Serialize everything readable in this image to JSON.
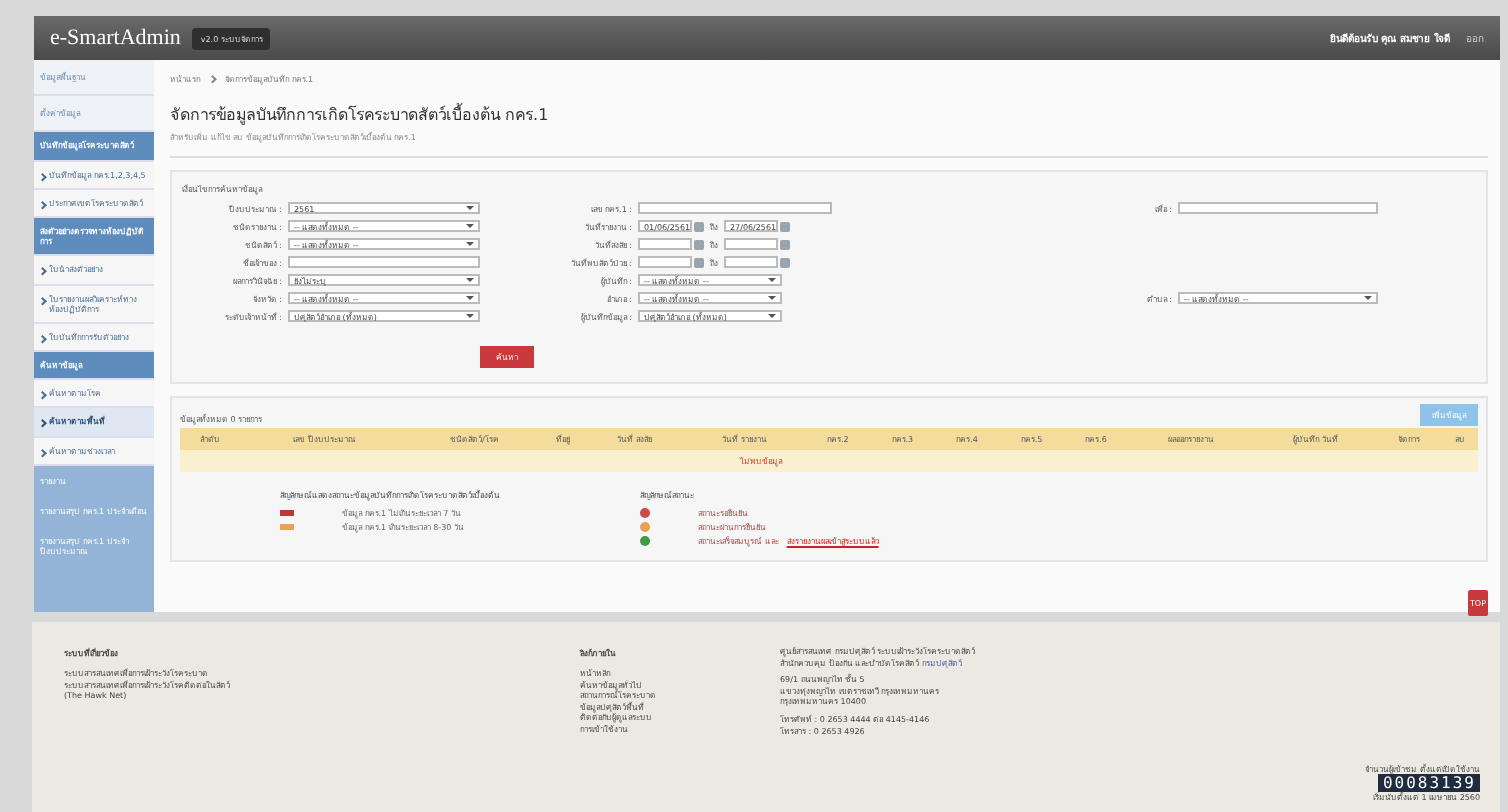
{
  "header": {
    "logo": "e-SmartAdmin",
    "version": "v2.0 ระบบจัดการ",
    "user": "ยินดีต้อนรับ คุณ สมชาย ใจดี",
    "logout": "ออก"
  },
  "sidebar": {
    "items": [
      {
        "kind": "menu",
        "label": "ข้อมูลพื้นฐาน",
        "selected": false
      },
      {
        "kind": "menu",
        "label": "ตั้งค่าข้อมูล",
        "selected": false
      },
      {
        "kind": "group",
        "label": "บันทึกข้อมูลโรคระบาดสัตว์",
        "selected": false
      },
      {
        "kind": "link",
        "label": "บันทึกข้อมูล กคร.1,2,3,4,5",
        "selected": false
      },
      {
        "kind": "link",
        "label": "ประกาศเขตโรคระบาดสัตว์",
        "selected": false
      },
      {
        "kind": "group",
        "label": "ส่งตัวอย่างตรวจทางห้องปฏิบัติการ",
        "selected": false
      },
      {
        "kind": "link",
        "label": "ใบนำส่งตัวอย่าง",
        "selected": false
      },
      {
        "kind": "link",
        "label": "ใบรายงานผลวิเคราะห์ทางห้องปฏิบัติการ",
        "selected": false
      },
      {
        "kind": "link",
        "label": "ใบบันทึกการรับตัวอย่าง",
        "selected": false
      },
      {
        "kind": "group",
        "label": "ค้นหาข้อมูล",
        "selected": false
      },
      {
        "kind": "link",
        "label": "ค้นหาตามโรค",
        "selected": false
      },
      {
        "kind": "link",
        "label": "ค้นหาตามพื้นที่",
        "selected": true
      },
      {
        "kind": "link",
        "label": "ค้นหาตามช่วงเวลา",
        "selected": false
      },
      {
        "kind": "panel",
        "label": "รายงาน",
        "selected": false
      },
      {
        "kind": "panel",
        "label": "รายงานสรุป กคร.1 ประจำเดือน",
        "selected": false
      },
      {
        "kind": "panel",
        "label": "รายงานสรุป กคร.1 ประจำปีงบประมาณ",
        "selected": false
      }
    ]
  },
  "breadcrumb": [
    "หน้าแรก",
    "จัดการข้อมูลบันทึก กคร.1"
  ],
  "title": "จัดการข้อมูลบันทึกการเกิดโรคระบาดสัตว์เบื้องต้น กคร.1",
  "subtitle": "สำหรับเพิ่ม แก้ไข ลบ ข้อมูลบันทึกการเกิดโรคระบาดสัตว์เบื้องต้น กคร.1",
  "search": {
    "heading": "เงื่อนไขการค้นหาข้อมูล",
    "rows": [
      {
        "left": {
          "kind": "select",
          "label": "ปีงบประมาณ :",
          "value": "2561"
        },
        "middle": {
          "kind": "text",
          "label": "เลข กคร.1 :"
        },
        "right": {
          "kind": "text",
          "label": "เพื่อ :"
        }
      },
      {
        "left": {
          "kind": "select",
          "label": "ชนิดรายงาน :",
          "value": "-- แสดงทั้งหมด --"
        },
        "middle": {
          "kind": "daterange",
          "label": "วันที่รายงาน :",
          "from": "01/06/2561",
          "to": "27/06/2561",
          "sep": "ถึง"
        }
      },
      {
        "left": {
          "kind": "select",
          "label": "ชนิดสัตว์ :",
          "value": "-- แสดงทั้งหมด --"
        },
        "middle": {
          "kind": "daterange",
          "label": "วันที่สงสัย :",
          "sep": "ถึง"
        }
      },
      {
        "left": {
          "kind": "text",
          "label": "ชื่อเจ้าของ :"
        },
        "middle": {
          "kind": "daterange",
          "label": "วันที่พบสัตว์ป่วย :",
          "sep": "ถึง"
        }
      },
      {
        "left": {
          "kind": "select",
          "label": "ผลการวินิจฉัย :",
          "value": "ยังไม่ระบุ"
        },
        "middle": {
          "kind": "select",
          "label": "ผู้บันทึก :",
          "value": "-- แสดงทั้งหมด --"
        }
      },
      {
        "left": {
          "kind": "select",
          "label": "จังหวัด :",
          "value": "-- แสดงทั้งหมด --"
        },
        "middle": {
          "kind": "select",
          "label": "อำเภอ :",
          "value": "-- แสดงทั้งหมด --"
        },
        "right": {
          "kind": "select",
          "label": "ตำบล :",
          "value": "-- แสดงทั้งหมด --"
        }
      },
      {
        "left": {
          "kind": "select",
          "label": "ระดับเจ้าหน้าที่ :",
          "value": "ปศุสัตว์อำเภอ (ทั้งหมด)"
        },
        "middle": {
          "kind": "select",
          "label": "ผู้บันทึกข้อมูล :",
          "value": "ปศุสัตว์อำเภอ (ทั้งหมด)"
        }
      }
    ],
    "button": "ค้นหา"
  },
  "results": {
    "heading": "ข้อมูลทั้งหมด 0 รายการ",
    "add_button": "เพิ่มข้อมูล",
    "columns": [
      "ลำดับ",
      "เลข ปีงบประมาณ",
      "ชนิดสัตว์/โรค",
      "ที่อยู่",
      "วันที่ สงสัย",
      "วันที่ รายงาน",
      "กคร.2",
      "กคร.3",
      "กคร.4",
      "กคร.5",
      "กคร.6",
      "ผลออกรายงาน",
      "ผู้บันทึก วันที่",
      "จัดการ",
      "ลบ"
    ],
    "empty": "ไม่พบข้อมูล"
  },
  "legend_left": {
    "title": "สัญลักษณ์แสดงสถานะข้อมูลบันทึกการเกิดโรคระบาดสัตว์เบื้องต้น",
    "items": [
      {
        "color": "#c0343a",
        "text": "ข้อมูล กคร.1 ไม่เกินระยะเวลา 7 วัน"
      },
      {
        "color": "#e8a35a",
        "text": "ข้อมูล กคร.1 เกินระยะเวลา 8-30 วัน"
      }
    ]
  },
  "legend_right": {
    "title": "สัญลักษณ์สถานะ",
    "items": [
      {
        "color": "#c94a4a",
        "text": "สถานะรอยืนยัน"
      },
      {
        "color": "#eba04e",
        "text": "สถานะผ่านการยืนยัน"
      },
      {
        "color": "#3f9b3f",
        "text": "สถานะเสร็จสมบูรณ์ และ",
        "link": "ส่งรายงานผลเข้าสู่ระบบแล้ว"
      }
    ]
  },
  "footer": {
    "col1": {
      "title": "ระบบที่เกี่ยวข้อง",
      "items": [
        "ระบบสารสนเทศเพื่อการเฝ้าระวังโรคระบาด",
        "ระบบสารสนเทศเพื่อการเฝ้าระวังโรคติดต่อในสัตว์",
        "(The Hawk Net)"
      ]
    },
    "col2": {
      "title": "ลิงก์ภายใน",
      "items": [
        "หน้าหลัก",
        "ค้นหาข้อมูลทั่วไป",
        "สถานการณ์โรคระบาด",
        "ข้อมูลปศุสัตว์พื้นที่",
        "ติดต่อกับผู้ดูแลระบบ",
        "การเข้าใช้งาน"
      ]
    },
    "col3": {
      "heading": "ศูนย์สารสนเทศ กรมปศุสัตว์ ระบบเฝ้าระวังโรคระบาดสัตว์",
      "heading2": "สำนักควบคุม ป้องกัน และบำบัดโรคสัตว์",
      "link": "กรมปศุสัตว์",
      "address": [
        "69/1 ถนนพญาไท ชั้น 5",
        "แขวงทุ่งพญาไท เขตราชเทวี กรุงเทพมหานคร",
        "กรุงเทพมหานคร 10400"
      ],
      "contact": [
        "โทรศัพท์ : 0 2653 4444 ต่อ 4145-4146",
        "โทรสาร : 0 2653 4926"
      ]
    },
    "counter": {
      "label": "จำนวนผู้เข้าชม ตั้งแต่เปิดใช้งาน",
      "value": "00083139",
      "since": "เริ่มนับตั้งแต่ 1 เมษายน 2560"
    }
  },
  "top_button": "TOP"
}
